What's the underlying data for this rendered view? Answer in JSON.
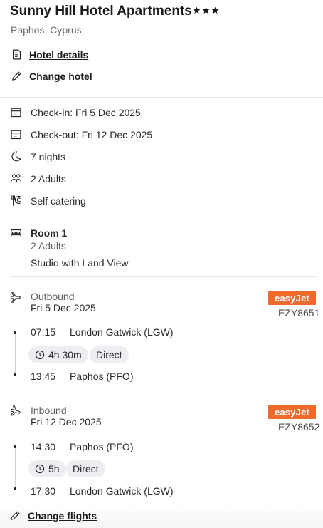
{
  "hotel": {
    "name": "Sunny Hill Hotel Apartments",
    "stars": 3,
    "location": "Paphos, Cyprus"
  },
  "links": {
    "hotel_details": "Hotel details",
    "change_hotel": "Change hotel",
    "change_flights": "Change flights"
  },
  "stay": {
    "check_in": "Check-in: Fri 5 Dec 2025",
    "check_out": "Check-out: Fri 12 Dec 2025",
    "nights": "7 nights",
    "guests": "2 Adults",
    "board": "Self catering"
  },
  "room": {
    "title": "Room 1",
    "occupancy": "2 Adults",
    "type": "Studio with Land View"
  },
  "outbound": {
    "label": "Outbound",
    "date": "Fri 5 Dec 2025",
    "airline": "easyJet",
    "airline_color": "#ee6b2b",
    "flight_number": "EZY8651",
    "depart_time": "07:15",
    "depart_airport": "London Gatwick (LGW)",
    "duration": "4h 30m",
    "stops": "Direct",
    "arrive_time": "13:45",
    "arrive_airport": "Paphos (PFO)"
  },
  "inbound": {
    "label": "Inbound",
    "date": "Fri 12 Dec 2025",
    "airline": "easyJet",
    "airline_color": "#ee6b2b",
    "flight_number": "EZY8652",
    "depart_time": "14:30",
    "depart_airport": "Paphos (PFO)",
    "duration": "5h",
    "stops": "Direct",
    "arrive_time": "17:30",
    "arrive_airport": "London Gatwick (LGW)"
  },
  "icons": {
    "star": "star-icon",
    "document": "document-icon",
    "pencil": "pencil-icon",
    "calendar": "calendar-icon",
    "moon": "moon-icon",
    "people": "people-icon",
    "cutlery": "cutlery-icon",
    "bed": "bed-icon",
    "plane_takeoff": "plane-takeoff-icon",
    "plane_landing": "plane-landing-icon",
    "clock": "clock-icon"
  }
}
